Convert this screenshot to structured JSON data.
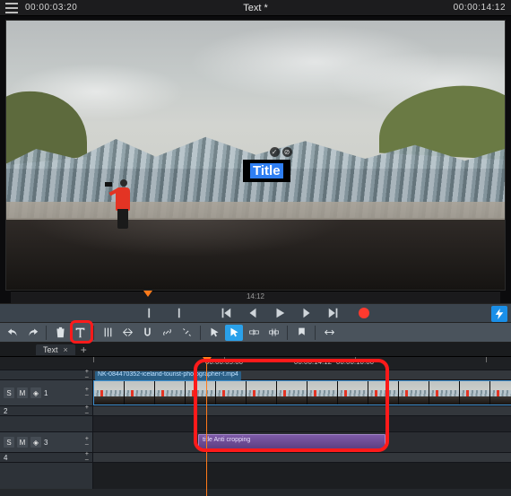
{
  "topbar": {
    "current_tc": "00:00:03:20",
    "doc_title": "Text *",
    "duration_tc": "00:00:14:12"
  },
  "preview": {
    "overlay_text": "Title",
    "mini_ruler_label": "14:12"
  },
  "transport": {
    "tooltips": {
      "in": "Set In",
      "out": "Set Out",
      "gostart": "Go to Start",
      "prev": "Previous",
      "play": "Play",
      "next": "Next",
      "goend": "Go to End",
      "record": "Record",
      "bolt": "Quick Export"
    }
  },
  "toolbar": {
    "tooltips": {
      "undo": "Undo",
      "redo": "Redo",
      "trash": "Delete",
      "text": "Text",
      "cut": "Cut",
      "splice": "Splice",
      "snap": "Snap",
      "link": "Link",
      "unlink": "Unlink",
      "pointer": "Select",
      "arrow2": "Move",
      "ripple": "Ripple",
      "roll": "Roll",
      "marker": "Marker",
      "zoom": "Zoom"
    }
  },
  "tabs": {
    "active": "Text",
    "close": "×",
    "add": "+"
  },
  "timeline": {
    "ruler": [
      {
        "pos": 104,
        "label": ""
      },
      {
        "pos": 250,
        "label": "00:00:05:00"
      },
      {
        "pos": 396,
        "label": "00:00:10:00"
      }
    ],
    "duration_lbl": "00:00:14:12",
    "tracks": {
      "video": {
        "num": "1",
        "clip_name": "NK-084470352-iceland-tourist-photographer-t.mp4"
      },
      "spacer2": {
        "num": "2"
      },
      "title": {
        "num": "3",
        "clip_label": "title   Anti cropping"
      },
      "spacer4": {
        "num": "4"
      }
    },
    "head_buttons": {
      "s": "S",
      "m": "M",
      "eye": "◈",
      "plus": "+",
      "minus": "–"
    }
  }
}
